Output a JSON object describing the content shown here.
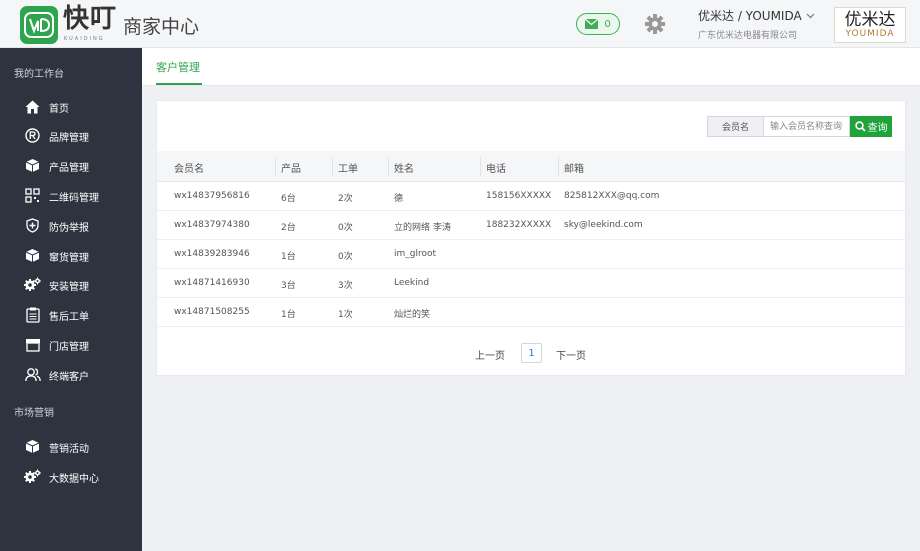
{
  "header": {
    "brand_name": "快叮",
    "brand_sub": "KUAIDING",
    "title": "商家中心",
    "message_count": "0",
    "user_name": "优米达 / YOUMIDA",
    "company": "广东优米达电器有限公司",
    "brand_logo_cn": "优米达",
    "brand_logo_en": "YOUMIDA",
    "accent_color": "#2ea44f"
  },
  "sidebar": {
    "section1": "我的工作台",
    "items1": [
      {
        "label": "首页",
        "icon": "home-icon"
      },
      {
        "label": "品牌管理",
        "icon": "registered-icon"
      },
      {
        "label": "产品管理",
        "icon": "box-icon"
      },
      {
        "label": "二维码管理",
        "icon": "qrcode-icon"
      },
      {
        "label": "防伪举报",
        "icon": "shield-icon"
      },
      {
        "label": "窜货管理",
        "icon": "cube-icon"
      },
      {
        "label": "安装管理",
        "icon": "gears-icon"
      },
      {
        "label": "售后工单",
        "icon": "clipboard-icon"
      },
      {
        "label": "门店管理",
        "icon": "store-icon"
      },
      {
        "label": "终端客户",
        "icon": "users-icon"
      }
    ],
    "section2": "市场营销",
    "items2": [
      {
        "label": "营销活动",
        "icon": "cube-icon"
      },
      {
        "label": "大数据中心",
        "icon": "gears-icon"
      }
    ]
  },
  "tab": {
    "active_label": "客户管理"
  },
  "search": {
    "label": "会员名",
    "placeholder": "输入会员名称查询",
    "button_label": "查询"
  },
  "table": {
    "columns": [
      "会员名",
      "产品",
      "工单",
      "姓名",
      "电话",
      "邮箱"
    ],
    "rows": [
      [
        "wx14837956816",
        "6台",
        "2次",
        "德",
        "158156XXXXX",
        "825812XXX@qq.com"
      ],
      [
        "wx14837974380",
        "2台",
        "0次",
        "立的网络 李涛",
        "188232XXXXX",
        "sky@leekind.com"
      ],
      [
        "wx14839283946",
        "1台",
        "0次",
        "im_glroot",
        "",
        ""
      ],
      [
        "wx14871416930",
        "3台",
        "3次",
        "Leekind",
        "",
        ""
      ],
      [
        "wx14871508255",
        "1台",
        "1次",
        "灿烂的笑",
        "",
        ""
      ]
    ]
  },
  "pager": {
    "prev_label": "上一页",
    "current_page": "1",
    "next_label": "下一页"
  }
}
